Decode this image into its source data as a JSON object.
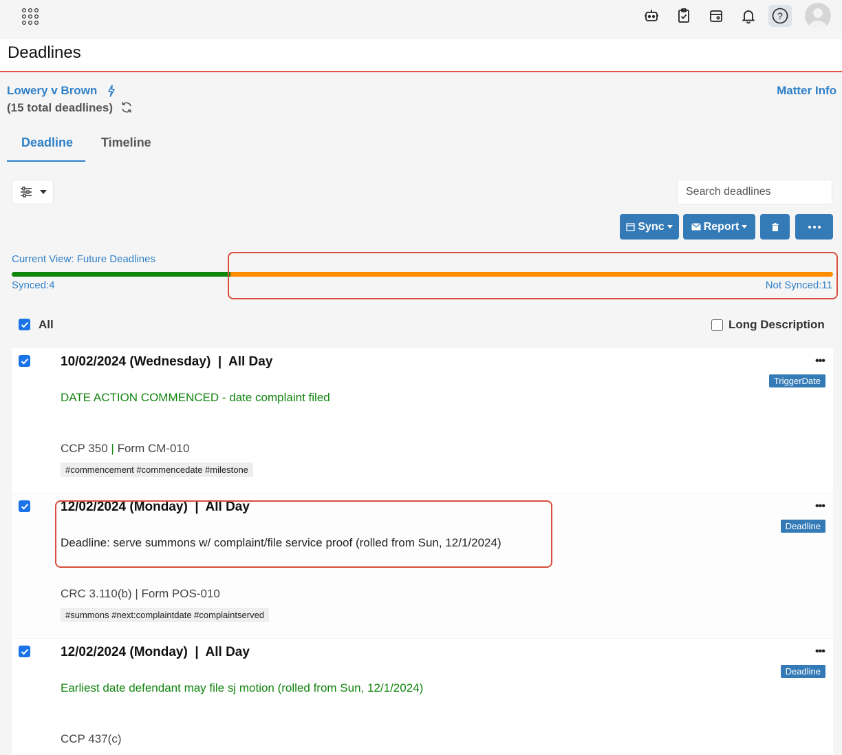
{
  "header": {
    "page_title": "Deadlines"
  },
  "matter": {
    "name": "Lowery v Brown",
    "total": "(15 total deadlines)",
    "info_link": "Matter Info"
  },
  "tabs": [
    {
      "label": "Deadline",
      "active": true
    },
    {
      "label": "Timeline",
      "active": false
    }
  ],
  "search": {
    "placeholder": "Search deadlines"
  },
  "toolbar": {
    "sync_label": "Sync",
    "report_label": "Report"
  },
  "sync_status": {
    "current_view": "Current View: Future Deadlines",
    "synced_label": "Synced:4",
    "not_synced_label": "Not Synced:11",
    "synced": 4,
    "not_synced": 11,
    "synced_color": "#11850e",
    "not_synced_color": "#ff8c00"
  },
  "list_controls": {
    "all_label": "All",
    "all_checked": true,
    "long_desc_label": "Long Description",
    "long_desc_checked": false
  },
  "deadlines": [
    {
      "date": "10/02/2024 (Wednesday)  |  All Day",
      "badge": "TriggerDate",
      "description": "DATE ACTION COMMENCED - date complaint filed",
      "rule_a": "CCP 350",
      "rule_sep": "|",
      "rule_b": "Form CM-010",
      "tags": "#commencement #commencedate #milestone",
      "checked": true
    },
    {
      "date": "12/02/2024 (Monday)  |  All Day",
      "badge": "Deadline",
      "description": "Deadline: serve summons w/ complaint/file service proof (rolled from Sun, 12/1/2024)",
      "rule_a": "CRC 3.110(b)",
      "rule_sep": "|",
      "rule_b": "Form POS-010",
      "tags": "#summons #next:complaintdate #complaintserved",
      "checked": true
    },
    {
      "date": "12/02/2024 (Monday)  |  All Day",
      "badge": "Deadline",
      "description": "Earliest date defendant may file sj motion (rolled from Sun, 12/1/2024)",
      "rule_a": "CCP 437(c)",
      "checked": true
    }
  ],
  "colors": {
    "accent": "#2f80c7",
    "button": "#337ab7",
    "highlight": "#d94c3c",
    "green_text": "#11850e"
  }
}
